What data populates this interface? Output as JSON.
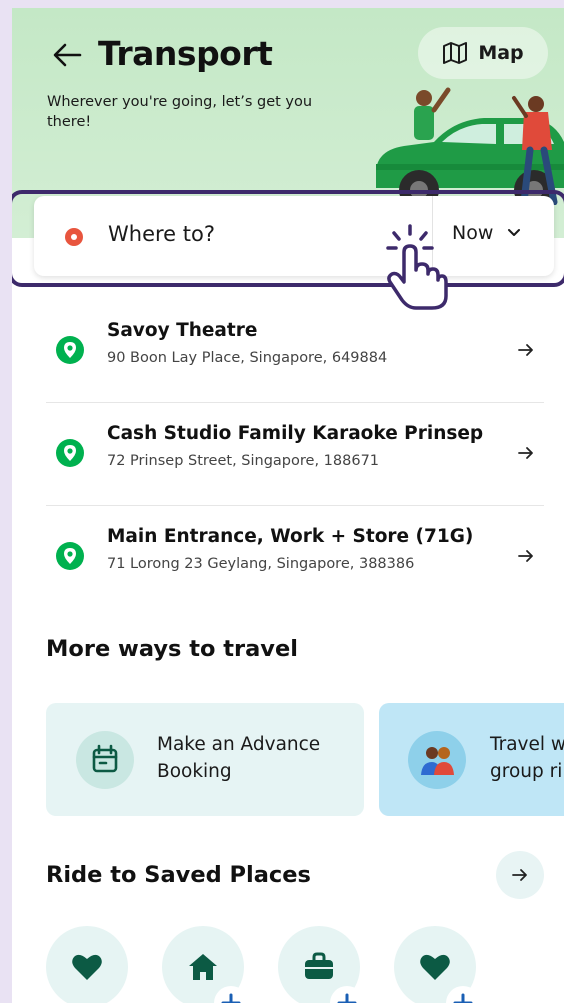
{
  "header": {
    "title": "Transport",
    "subtitle": "Wherever you're going, let’s get you there!",
    "map_button": "Map"
  },
  "search": {
    "placeholder": "Where to?",
    "time": "Now"
  },
  "recent_places": [
    {
      "name": "Savoy Theatre",
      "address": "90 Boon Lay Place, Singapore, 649884"
    },
    {
      "name": "Cash Studio Family Karaoke Prinsep",
      "address": "72 Prinsep Street, Singapore, 188671"
    },
    {
      "name": "Main Entrance, Work + Store (71G)",
      "address": "71 Lorong 23 Geylang, Singapore, 388386"
    }
  ],
  "more_ways": {
    "title": "More ways to travel",
    "cards": [
      {
        "label": "Make an Advance\nBooking",
        "icon": "calendar-icon"
      },
      {
        "label": "Travel w\ngroup ri",
        "icon": "group-icon"
      }
    ]
  },
  "saved_places": {
    "title": "Ride to Saved Places",
    "items": [
      {
        "icon": "heart-icon"
      },
      {
        "icon": "home-icon"
      },
      {
        "icon": "briefcase-icon"
      },
      {
        "icon": "heart-icon"
      }
    ]
  },
  "colors": {
    "brand_green": "#00b14f",
    "hero_bg": "#c4e8c6",
    "highlight_outline": "#3d2a6b",
    "search_dot": "#e8553e",
    "saved_icon": "#0c5a44"
  }
}
